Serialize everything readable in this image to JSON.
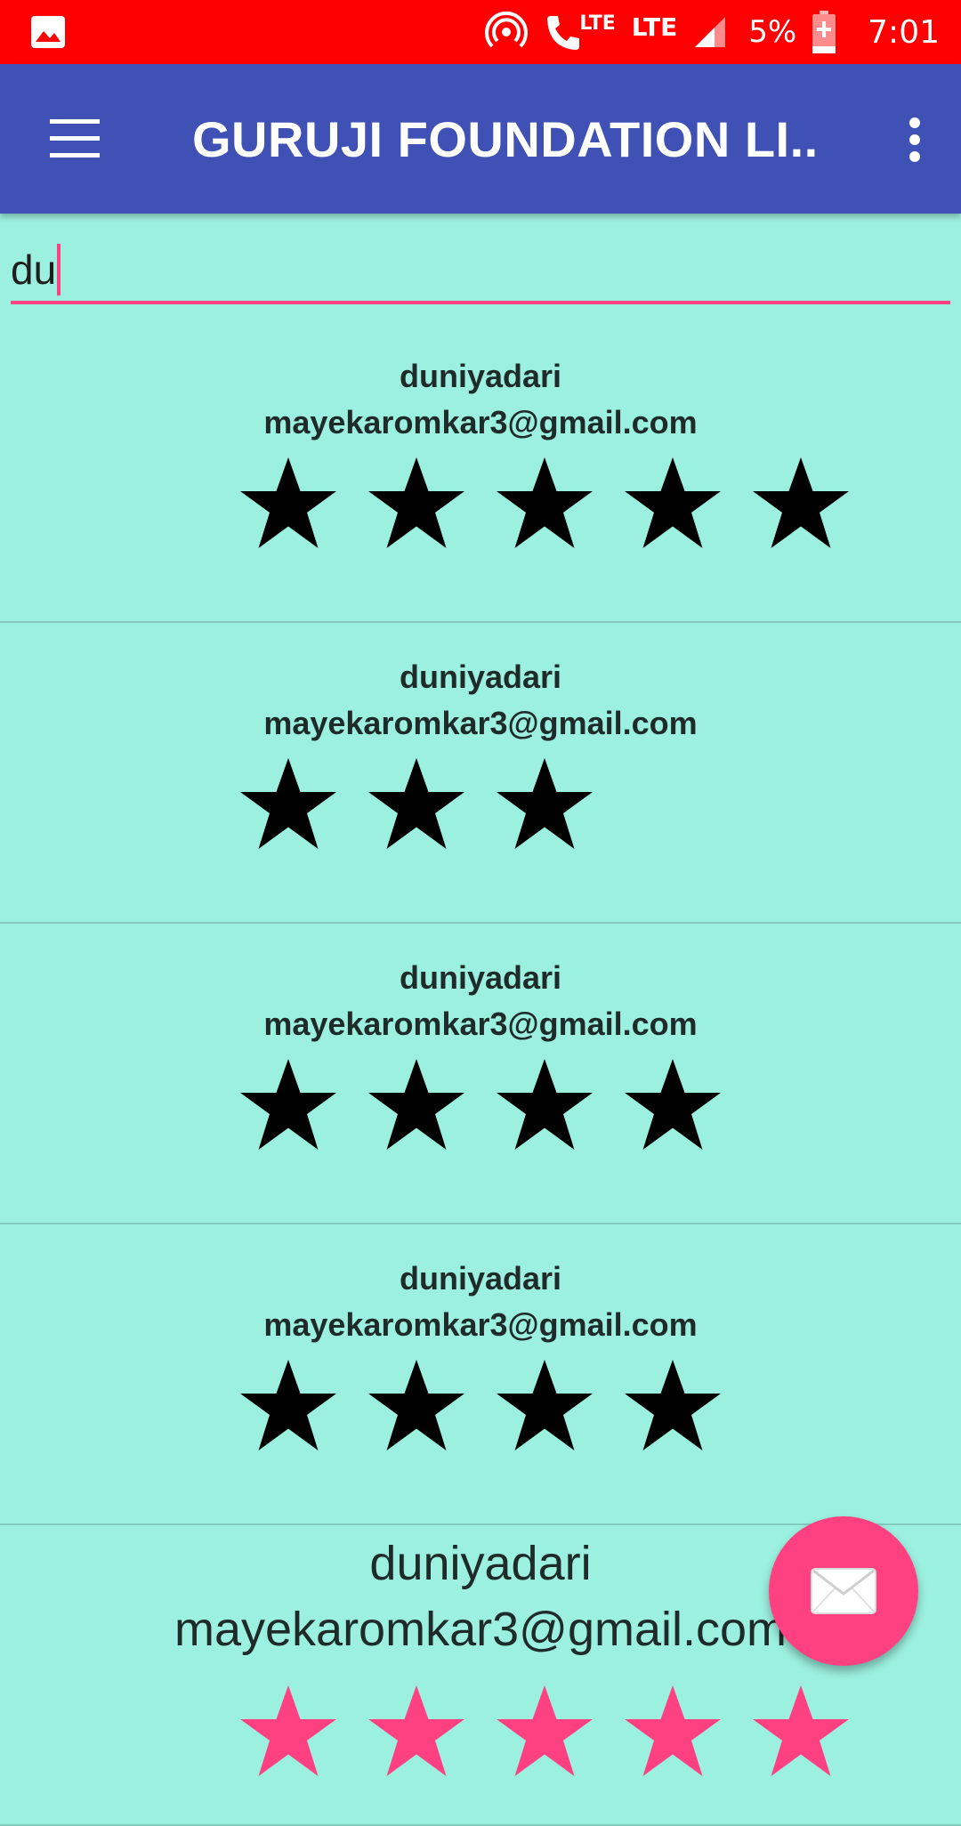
{
  "status_bar": {
    "lte_1": "LTE",
    "lte_2": "LTE",
    "battery": "5%",
    "time": "7:01",
    "color": "#ff0000"
  },
  "app_bar": {
    "title": "GURUJI FOUNDATION LI...",
    "color": "#3f51b5"
  },
  "search": {
    "value": "du",
    "accent": "#ff4081"
  },
  "results": [
    {
      "name": "duniyadari",
      "email": "mayekaromkar3@gmail.com",
      "rating": 5
    },
    {
      "name": "duniyadari",
      "email": "mayekaromkar3@gmail.com",
      "rating": 3
    },
    {
      "name": "duniyadari",
      "email": "mayekaromkar3@gmail.com",
      "rating": 4
    },
    {
      "name": "duniyadari",
      "email": "mayekaromkar3@gmail.com",
      "rating": 4
    },
    {
      "name": "duniyadari",
      "email": "mayekaromkar3@gmail.com",
      "rating": 5
    }
  ],
  "fab": {
    "icon": "envelope-icon"
  },
  "background": "#9cf0df"
}
